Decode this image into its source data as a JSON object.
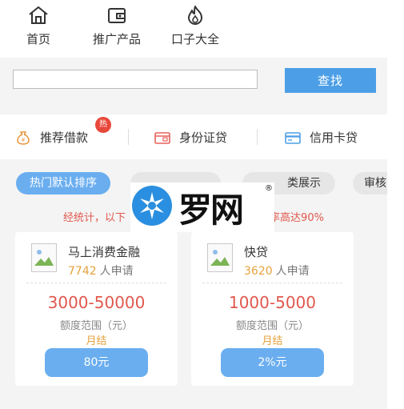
{
  "nav": {
    "items": [
      {
        "label": "首页",
        "icon": "home-icon"
      },
      {
        "label": "推广产品",
        "icon": "wallet-icon"
      },
      {
        "label": "口子大全",
        "icon": "fire-icon"
      }
    ]
  },
  "search": {
    "value": "",
    "placeholder": "",
    "button_label": "查找"
  },
  "categories": [
    {
      "label": "推荐借款",
      "icon": "money-bag-icon",
      "badge": "热"
    },
    {
      "label": "身份证贷",
      "icon": "id-card-icon"
    },
    {
      "label": "信用卡贷",
      "icon": "credit-card-icon"
    }
  ],
  "filters": [
    {
      "label": "热门默认排序",
      "active": true
    },
    {
      "label": "",
      "active": false
    },
    {
      "label": "类展示",
      "active": false
    },
    {
      "label": "审核",
      "active": false
    }
  ],
  "stats": {
    "left": "经统计，以下",
    "right": "率高达90%"
  },
  "products": [
    {
      "name": "马上消费金融",
      "applicants": "7742",
      "applicants_suffix": "人申请",
      "range": "3000-50000",
      "range_label": "额度范围（元）",
      "settle": "月结",
      "rate": "80元"
    },
    {
      "name": "快贷",
      "applicants": "3620",
      "applicants_suffix": "人申请",
      "range": "1000-5000",
      "range_label": "额度范围（元）",
      "settle": "月结",
      "rate": "2%元"
    }
  ],
  "watermark": {
    "text": "罗网",
    "mark": "®",
    "icon": "luowang-logo-icon"
  },
  "colors": {
    "accent": "#4c9fe6",
    "pill_active": "#6aaef0",
    "highlight_red": "#e0584d",
    "applicant_orange": "#e6a23c",
    "badge_red": "#e8483b"
  }
}
